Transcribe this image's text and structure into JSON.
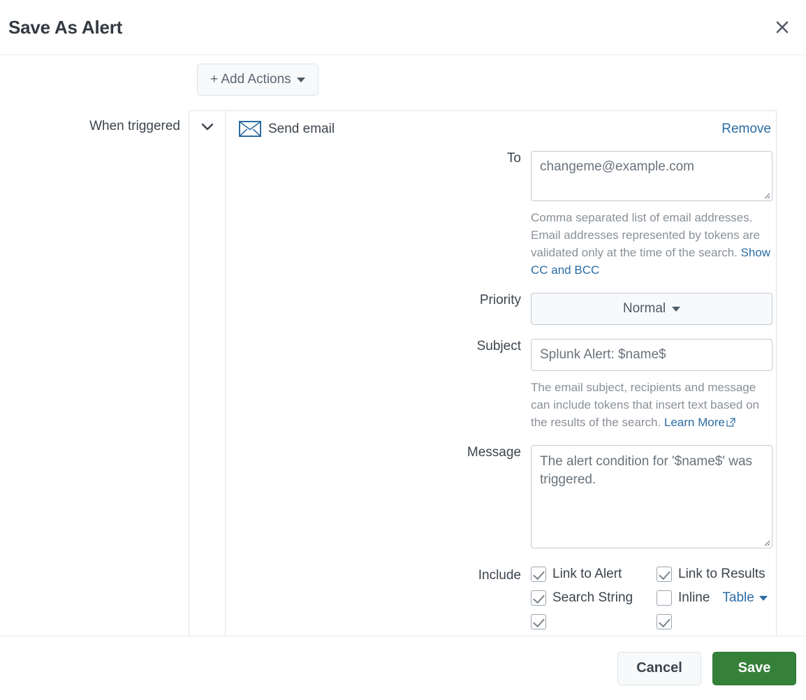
{
  "dialog": {
    "title": "Save As Alert",
    "close_icon": "close-icon"
  },
  "toolbar": {
    "add_actions_label": "+ Add Actions"
  },
  "trigger_section": {
    "label": "When triggered",
    "toggle_icon": "chevron-down-icon"
  },
  "email_action": {
    "icon": "envelope-icon",
    "title": "Send email",
    "remove_label": "Remove",
    "fields": {
      "to": {
        "label": "To",
        "value": "changeme@example.com",
        "help_line1": "Comma separated list of email addresses.",
        "help_line2": "Email addresses represented by tokens are",
        "help_line3": "validated only at the time of the search.",
        "help_link": "Show CC and BCC"
      },
      "priority": {
        "label": "Priority",
        "value": "Normal",
        "caret_icon": "caret-down-icon"
      },
      "subject": {
        "label": "Subject",
        "value": "Splunk Alert: $name$",
        "help_line1": "The email subject, recipients and message",
        "help_line2": "can include tokens that insert text based on",
        "help_line3": "the results of the search.",
        "help_link": "Learn More",
        "help_link_icon": "external-link-icon"
      },
      "message": {
        "label": "Message",
        "value": "The alert condition for '$name$' was triggered."
      },
      "include": {
        "label": "Include",
        "options": [
          {
            "label": "Link to Alert",
            "checked": true
          },
          {
            "label": "Link to Results",
            "checked": true
          },
          {
            "label": "Search String",
            "checked": true
          },
          {
            "label": "Inline",
            "checked": false
          }
        ],
        "inline_format": "Table"
      }
    }
  },
  "footer": {
    "cancel_label": "Cancel",
    "save_label": "Save"
  },
  "colors": {
    "link": "#2b6ca3",
    "save_green": "#35813a",
    "accent_blue": "#2b6ca3",
    "text": "#3c444d",
    "muted": "#8a9097"
  }
}
